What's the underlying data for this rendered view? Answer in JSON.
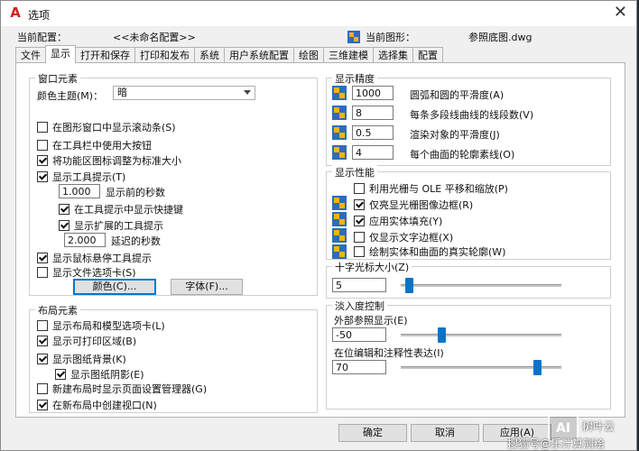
{
  "window": {
    "title": "选项",
    "close_glyph": "✕"
  },
  "profile": {
    "current_profile_label": "当前配置：",
    "current_profile_value": "<<未命名配置>>",
    "current_drawing_label": "当前图形：",
    "current_drawing_value": "参照底图.dwg"
  },
  "tabs": [
    "文件",
    "显示",
    "打开和保存",
    "打印和发布",
    "系统",
    "用户系统配置",
    "绘图",
    "三维建模",
    "选择集",
    "配置"
  ],
  "active_tab": "显示",
  "window_elements": {
    "title": "窗口元素",
    "color_theme_label": "颜色主题(M)：",
    "color_theme_value": "暗",
    "checkboxes": [
      {
        "label": "在图形窗口中显示滚动条(S)",
        "checked": false
      },
      {
        "label": "在工具栏中使用大按钮",
        "checked": false
      },
      {
        "label": "将功能区图标调整为标准大小",
        "checked": true
      },
      {
        "label": "显示工具提示(T)",
        "checked": true
      }
    ],
    "tooltip_delay_value": "1.000",
    "tooltip_delay_label": "显示前的秒数",
    "show_shortcut": {
      "label": "在工具提示中显示快捷键",
      "checked": true
    },
    "show_extended": {
      "label": "显示扩展的工具提示",
      "checked": true
    },
    "extended_delay_value": "2.000",
    "extended_delay_label": "延迟的秒数",
    "rollover": {
      "label": "显示鼠标悬停工具提示",
      "checked": true
    },
    "file_tabs": {
      "label": "显示文件选项卡(S)",
      "checked": false
    },
    "colors_button": "颜色(C)...",
    "fonts_button": "字体(F)..."
  },
  "layout_elements": {
    "title": "布局元素",
    "checkboxes": [
      {
        "label": "显示布局和模型选项卡(L)",
        "checked": false
      },
      {
        "label": "显示可打印区域(B)",
        "checked": true
      },
      {
        "label": "显示图纸背景(K)",
        "checked": true
      }
    ],
    "paper_shadow": {
      "label": "显示图纸阴影(E)",
      "checked": true
    },
    "page_setup": {
      "label": "新建布局时显示页面设置管理器(G)",
      "checked": false
    },
    "create_viewport": {
      "label": "在新布局中创建视口(N)",
      "checked": true
    }
  },
  "display_resolution": {
    "title": "显示精度",
    "rows": [
      {
        "value": "1000",
        "label": "圆弧和圆的平滑度(A)"
      },
      {
        "value": "8",
        "label": "每条多段线曲线的线段数(V)"
      },
      {
        "value": "0.5",
        "label": "渲染对象的平滑度(J)"
      },
      {
        "value": "4",
        "label": "每个曲面的轮廓素线(O)"
      }
    ]
  },
  "display_performance": {
    "title": "显示性能",
    "items": [
      {
        "label": "利用光栅与 OLE 平移和缩放(P)",
        "checked": false,
        "icon": false
      },
      {
        "label": "仅亮显光栅图像边框(R)",
        "checked": true,
        "icon": true
      },
      {
        "label": "应用实体填充(Y)",
        "checked": true,
        "icon": true
      },
      {
        "label": "仅显示文字边框(X)",
        "checked": false,
        "icon": true
      },
      {
        "label": "绘制实体和曲面的真实轮廓(W)",
        "checked": false,
        "icon": true
      }
    ]
  },
  "crosshair": {
    "title": "十字光标大小(Z)",
    "value": "5",
    "slider_fraction": 0.05
  },
  "fade_control": {
    "title": "淡入度控制",
    "xref_label": "外部参照显示(E)",
    "xref_value": "-50",
    "xref_fraction": 0.25,
    "inplace_label": "在位编辑和注释性表达(I)",
    "inplace_value": "70",
    "inplace_fraction": 0.85
  },
  "buttons": {
    "ok": "确定",
    "cancel": "取消",
    "apply": "应用(A)"
  },
  "watermark": {
    "logo": "AI",
    "text1": "树叶云",
    "text2": "搜狐号@乐计算测绘"
  },
  "colors": {
    "accent": "#0a74c7",
    "dialog_bg": "#f0f0f0",
    "app_red": "#d21f1f"
  }
}
